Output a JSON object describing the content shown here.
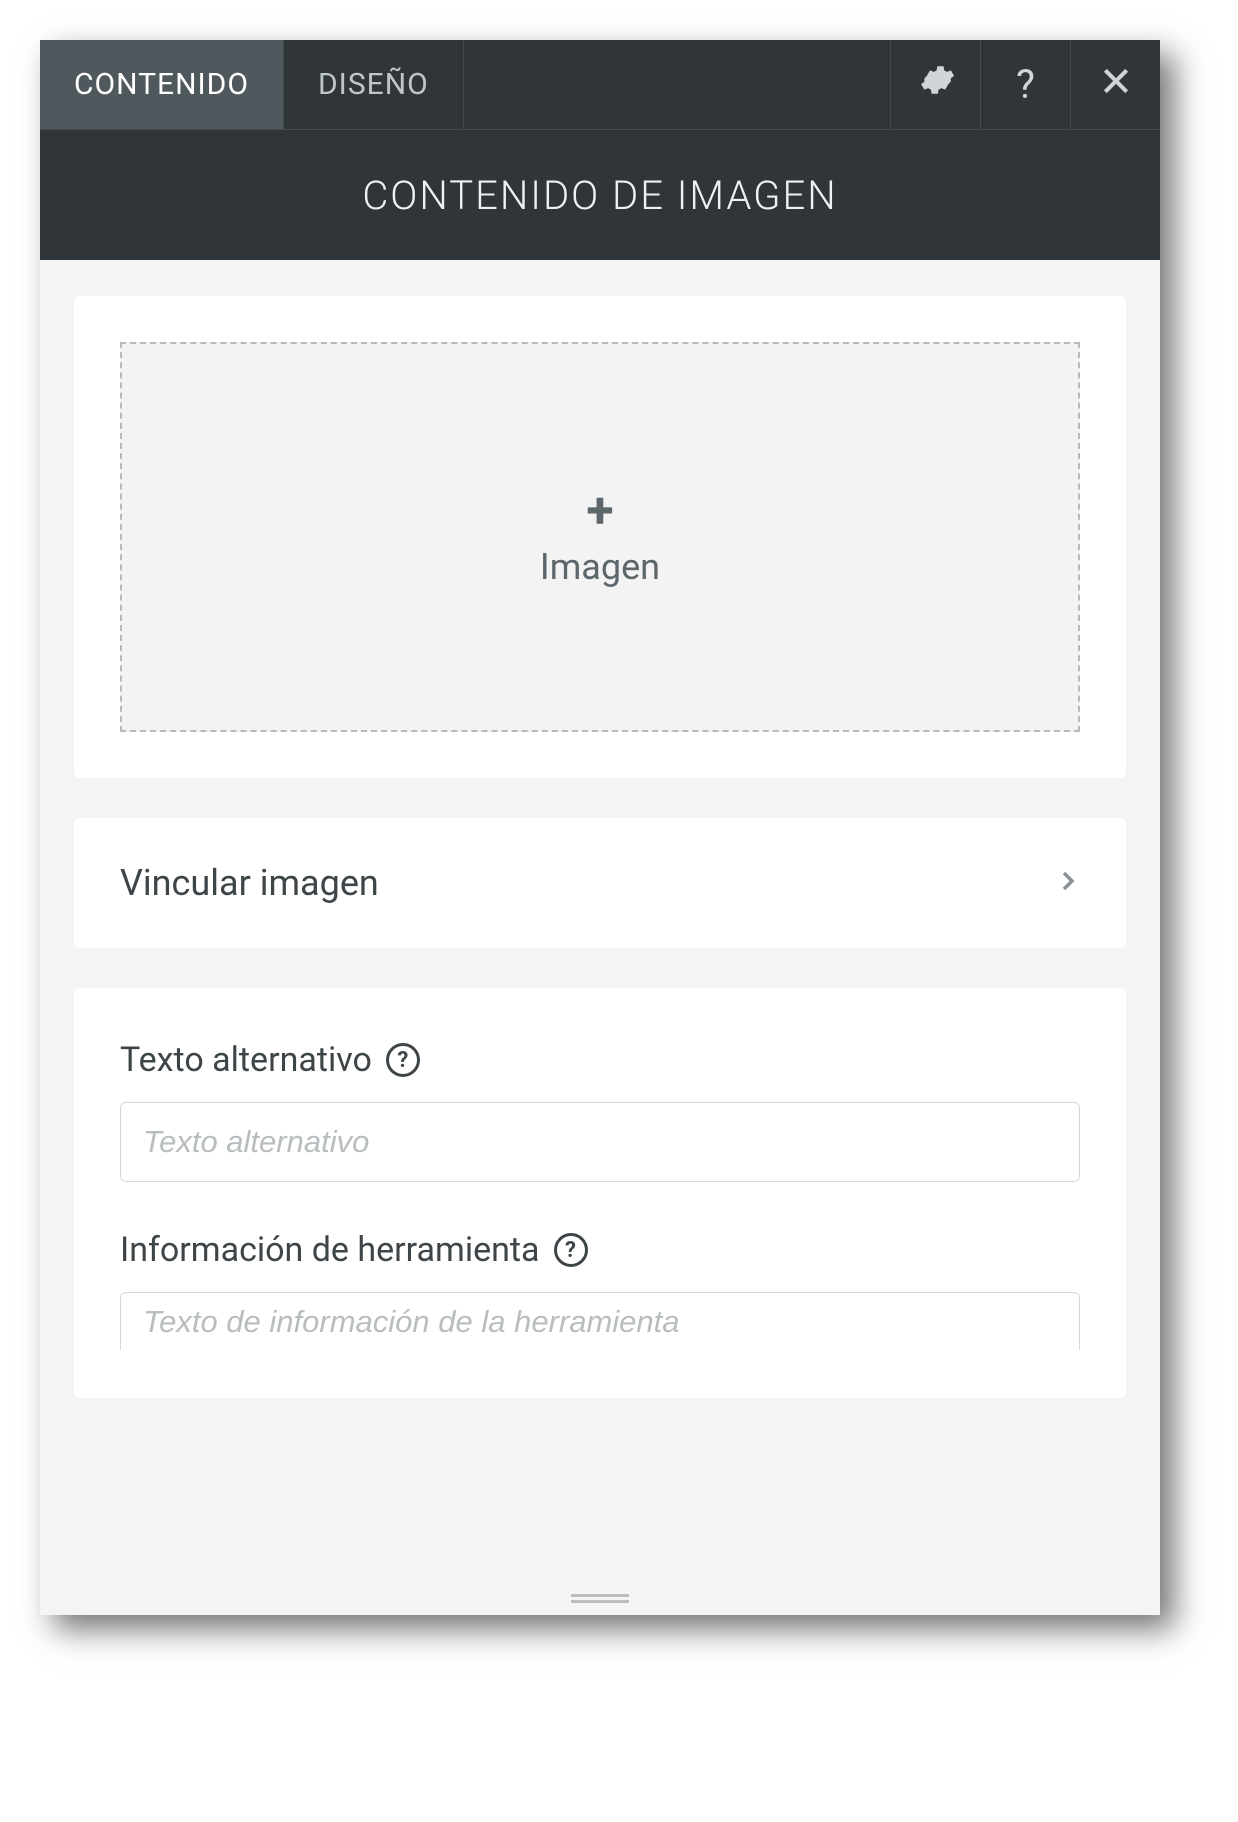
{
  "tabs": {
    "content": "CONTENIDO",
    "design": "DISEÑO"
  },
  "panel_title": "CONTENIDO DE IMAGEN",
  "dropzone": {
    "label": "Imagen"
  },
  "link_image": {
    "label": "Vincular imagen"
  },
  "alt_text": {
    "label": "Texto alternativo",
    "placeholder": "Texto alternativo",
    "value": ""
  },
  "tooltip_info": {
    "label": "Información de herramienta",
    "placeholder": "Texto de información de la herramienta",
    "value": ""
  },
  "icons": {
    "settings": "gear",
    "help": "?",
    "close": "×",
    "plus": "+",
    "chevron_right": "›",
    "question_circle": "?"
  }
}
